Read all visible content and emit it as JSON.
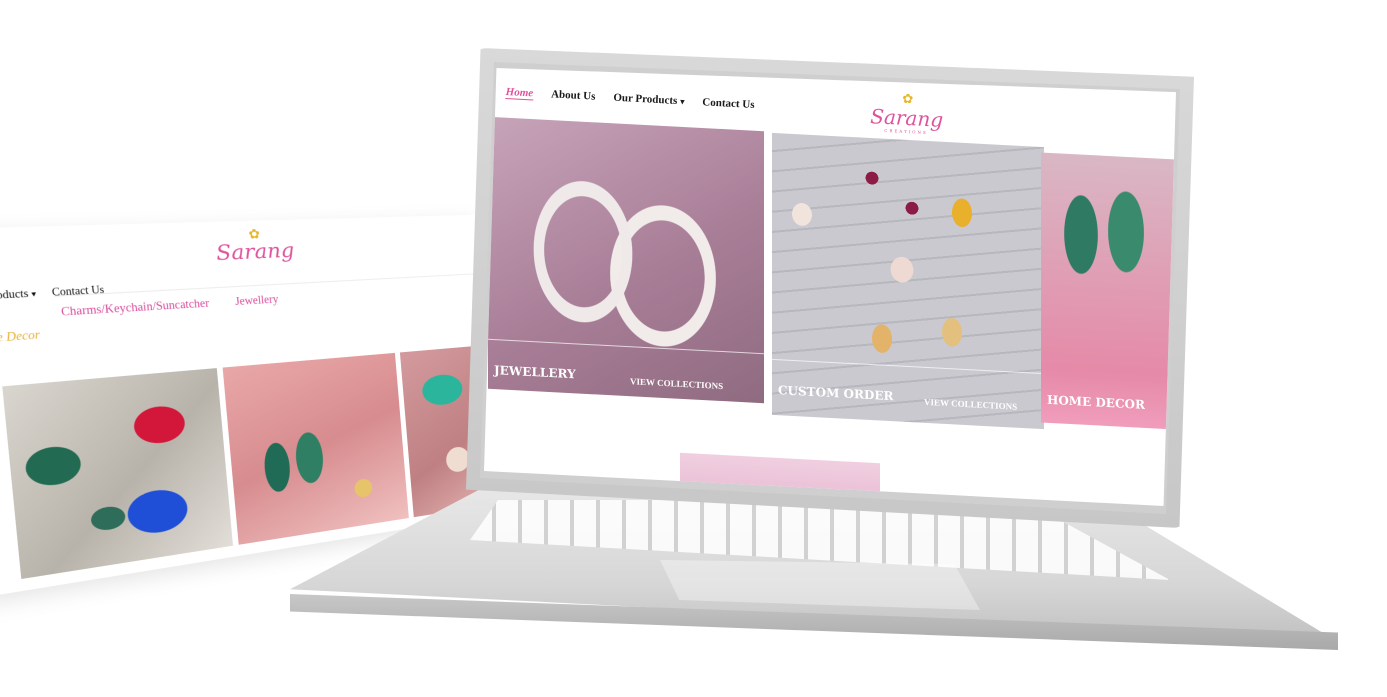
{
  "brand": {
    "name": "Sarang",
    "tagline": "CREATIONS"
  },
  "colors": {
    "accent": "#e0529c",
    "gold": "#e5b62c"
  },
  "laptop_site": {
    "nav": {
      "home": "Home",
      "about": "About Us",
      "products": "Our Products",
      "contact": "Contact Us"
    },
    "cards": [
      {
        "title": "JEWELLERY",
        "cta": "VIEW COLLECTIONS"
      },
      {
        "title": "CUSTOM ORDER",
        "cta": "VIEW COLLECTIONS"
      },
      {
        "title": "HOME DECOR"
      }
    ]
  },
  "side_site": {
    "nav": {
      "products": "Our Products",
      "contact": "Contact Us"
    },
    "submenu": [
      "Charms/Keychain/Suncatcher",
      "Jewellery"
    ],
    "home_decor": "Home Decor"
  },
  "icons": [
    "lotus-icon",
    "caret-down-icon"
  ]
}
